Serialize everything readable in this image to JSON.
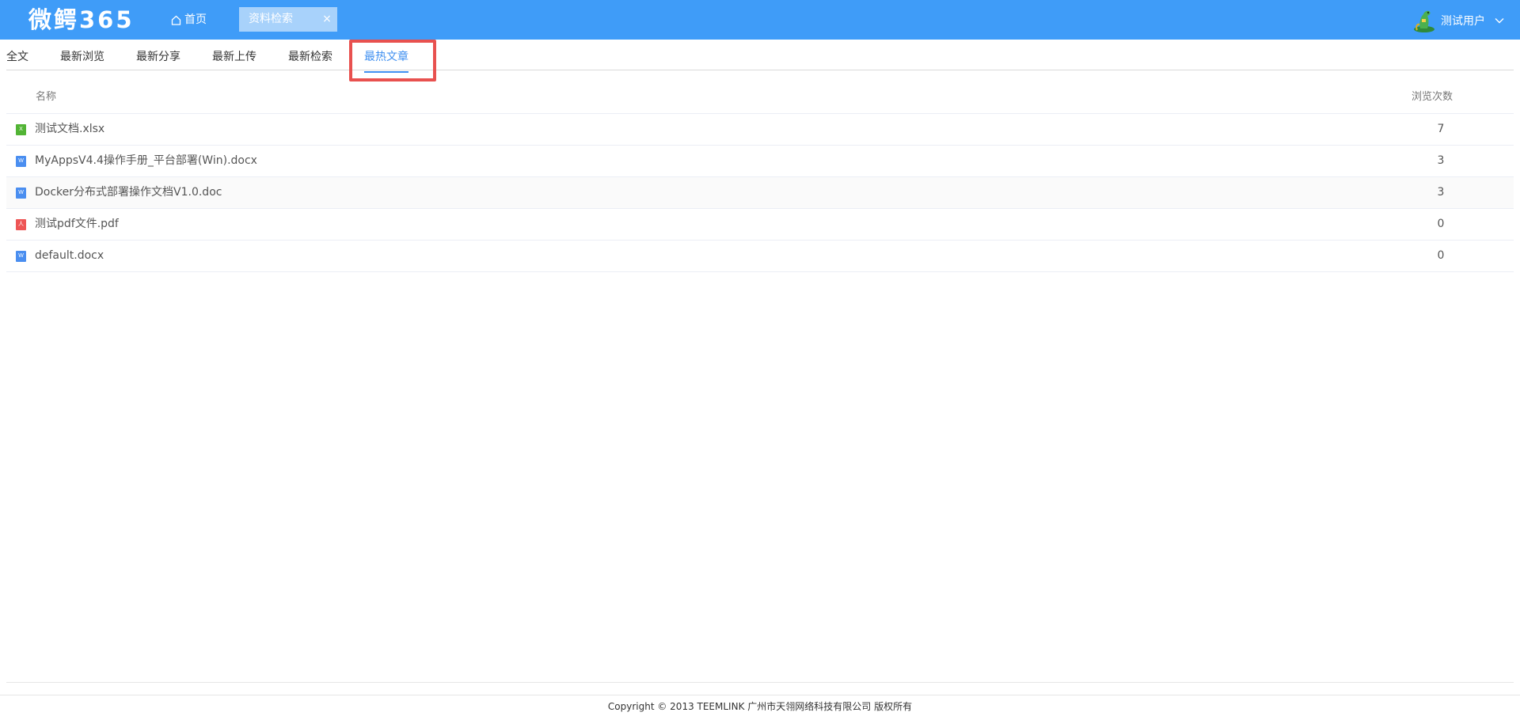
{
  "header": {
    "logo": "微鳄365",
    "home_label": "首页",
    "open_tab": {
      "label": "资料检索",
      "close": "×"
    },
    "user": {
      "name": "测试用户"
    }
  },
  "subtabs": [
    {
      "label": "全文",
      "active": false
    },
    {
      "label": "最新浏览",
      "active": false
    },
    {
      "label": "最新分享",
      "active": false
    },
    {
      "label": "最新上传",
      "active": false
    },
    {
      "label": "最新检索",
      "active": false
    },
    {
      "label": "最热文章",
      "active": true
    }
  ],
  "table": {
    "columns": {
      "name": "名称",
      "views": "浏览次数"
    },
    "rows": [
      {
        "name": "测试文档.xlsx",
        "type": "xlsx",
        "icon": "X",
        "views": "7"
      },
      {
        "name": "MyAppsV4.4操作手册_平台部署(Win).docx",
        "type": "docx",
        "icon": "W",
        "views": "3"
      },
      {
        "name": "Docker分布式部署操作文档V1.0.doc",
        "type": "doc",
        "icon": "W",
        "views": "3"
      },
      {
        "name": "测试pdf文件.pdf",
        "type": "pdf",
        "icon": "人",
        "views": "0"
      },
      {
        "name": "default.docx",
        "type": "docx",
        "icon": "W",
        "views": "0"
      }
    ]
  },
  "footer": {
    "copyright": "Copyright © 2013 TEEMLINK 广州市天翎网络科技有限公司 版权所有"
  },
  "colors": {
    "header_bg": "#3f9cf8",
    "active_tab": "#3f8ff0",
    "highlight_box": "#e8514f",
    "xlsx_icon": "#52b435",
    "word_icon": "#4a8ef0",
    "pdf_icon": "#ee5555"
  }
}
